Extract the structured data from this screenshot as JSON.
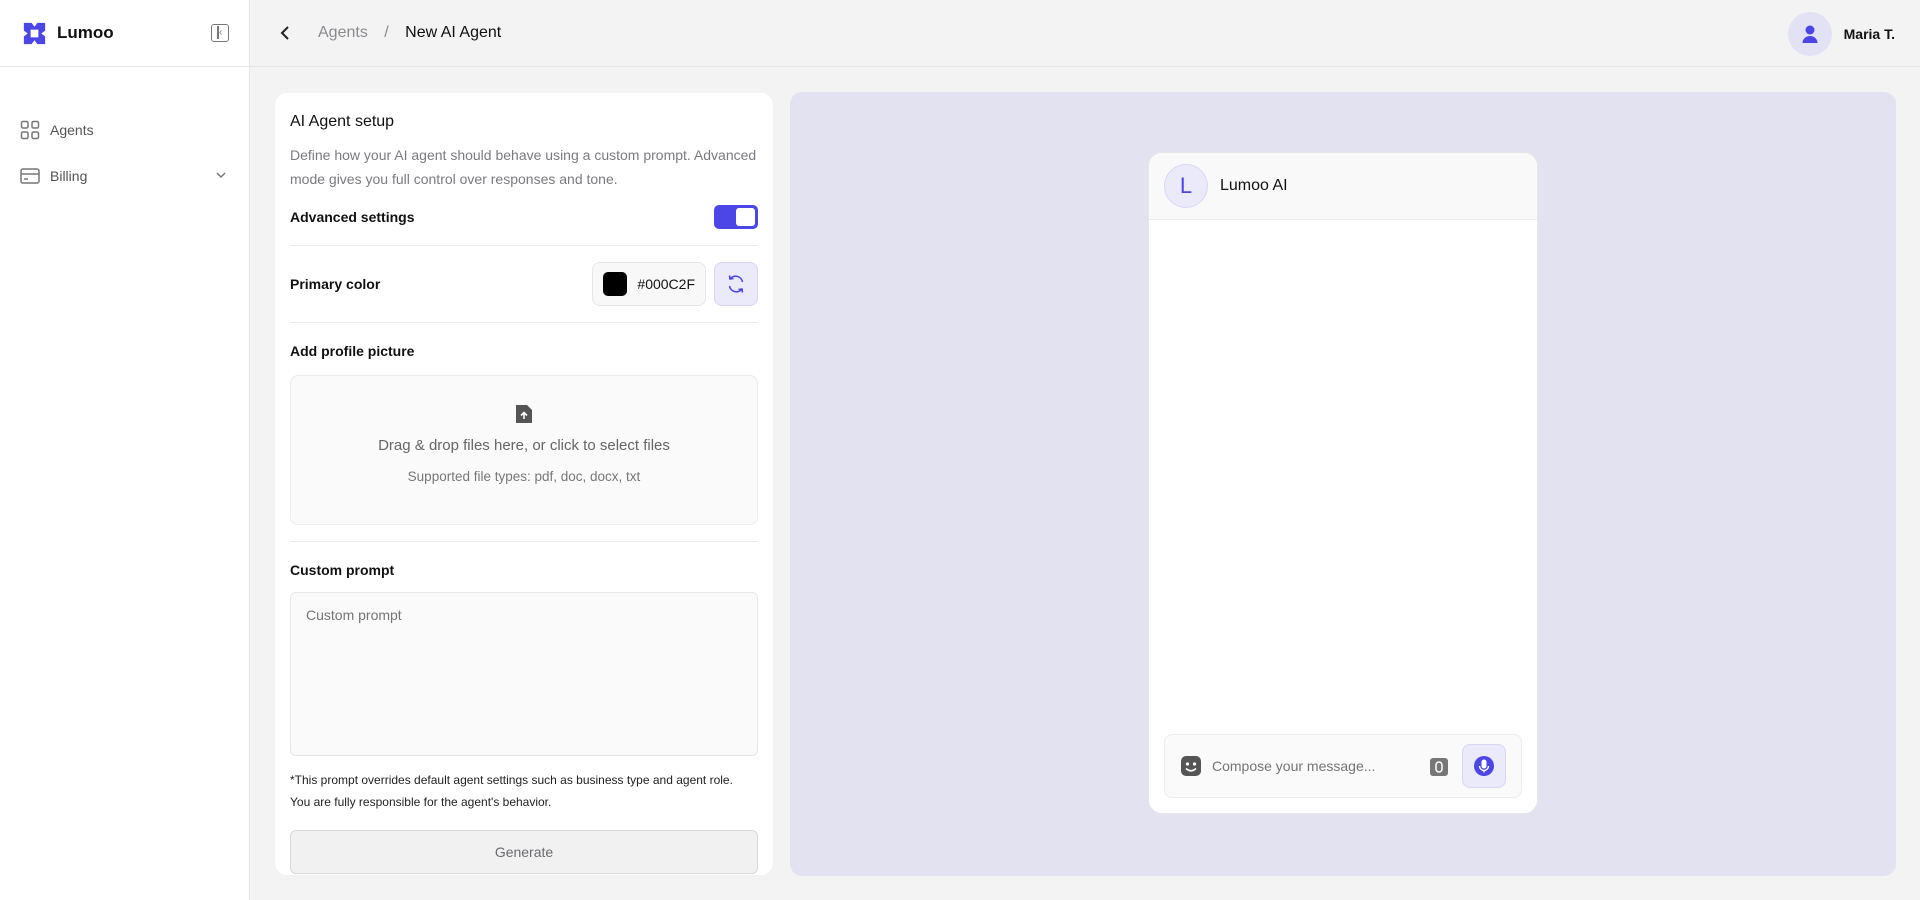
{
  "brand": {
    "name": "Lumoo",
    "accent": "#4b46e5"
  },
  "sidebar": {
    "items": [
      {
        "label": "Agents",
        "icon": "grid-icon"
      },
      {
        "label": "Billing",
        "icon": "card-icon",
        "expandable": true
      }
    ]
  },
  "header": {
    "breadcrumb": {
      "parent": "Agents",
      "separator": "/",
      "current": "New AI Agent"
    },
    "user": {
      "name": "Maria T."
    }
  },
  "setup": {
    "title": "AI Agent setup",
    "description": "Define how your AI agent should behave using a custom prompt. Advanced mode gives you full control over responses and tone.",
    "advanced_label": "Advanced settings",
    "advanced_enabled": true,
    "primary_color_label": "Primary color",
    "primary_color_value": "#000C2F",
    "profile_picture_label": "Add profile picture",
    "upload_title": "Drag & drop files here, or click to select files",
    "upload_subtitle": "Supported file types: pdf, doc, docx, txt",
    "custom_prompt_label": "Custom prompt",
    "custom_prompt_placeholder": "Custom prompt",
    "note_line1": "*This prompt overrides default agent settings such as business type and agent role.",
    "note_line2": "You are fully responsible for the agent's behavior.",
    "generate_label": "Generate"
  },
  "preview": {
    "agent_initial": "L",
    "agent_name": "Lumoo AI",
    "composer_placeholder": "Compose your message..."
  }
}
